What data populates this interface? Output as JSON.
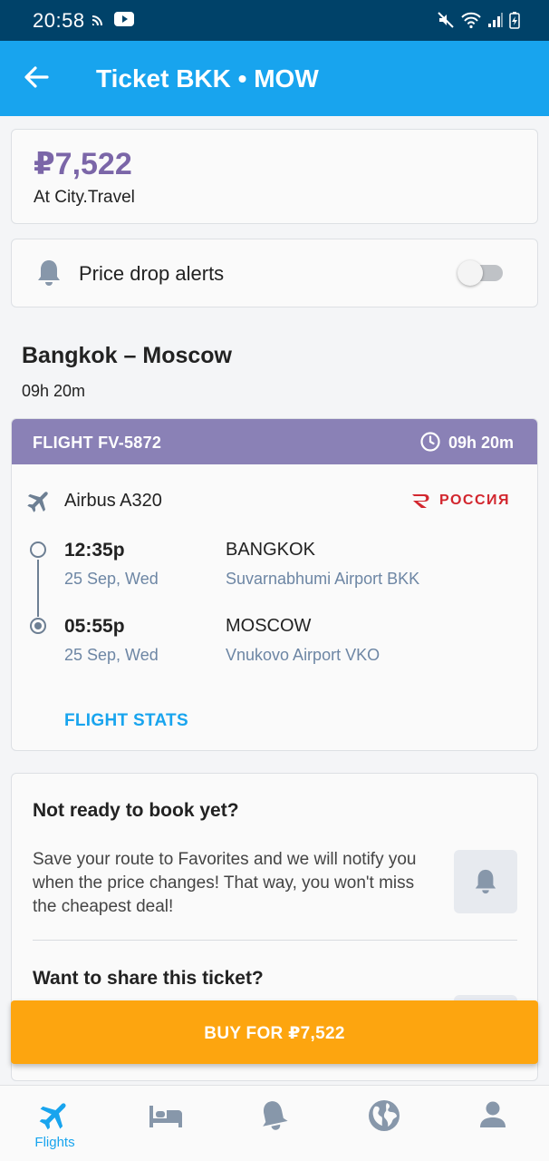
{
  "status_bar": {
    "time": "20:58"
  },
  "app_bar": {
    "title": "Ticket BKK • MOW",
    "back_icon": "arrow-left-icon"
  },
  "price_card": {
    "price": "₽7,522",
    "seller": "At City.Travel"
  },
  "price_alert": {
    "label": "Price drop alerts",
    "enabled": false
  },
  "route": {
    "title": "Bangkok – Moscow",
    "duration": "09h 20m"
  },
  "flight": {
    "number": "FLIGHT FV-5872",
    "duration": "09h 20m",
    "aircraft": "Airbus A320",
    "airline": "РОССИЯ",
    "departure": {
      "time": "12:35p",
      "date": "25 Sep, Wed",
      "city": "BANGKOK",
      "airport": "Suvarnabhumi Airport BKK"
    },
    "arrival": {
      "time": "05:55p",
      "date": "25 Sep, Wed",
      "city": "MOSCOW",
      "airport": "Vnukovo Airport VKO"
    },
    "stats_link": "FLIGHT STATS",
    "header_color": "#8a81b6"
  },
  "booking": {
    "heading": "Not ready to book yet?",
    "body": "Save your route to Favorites and we will notify you when the price changes! That way, you won't miss the cheapest deal!",
    "share_heading": "Want to share this ticket?"
  },
  "buy_button": {
    "label": "BUY FOR ₽7,522",
    "color": "#fda50f"
  },
  "bottom_nav": {
    "items": [
      {
        "icon": "airplane-icon",
        "label": "Flights",
        "active": true
      },
      {
        "icon": "hotel-bed-icon",
        "label": "",
        "active": false
      },
      {
        "icon": "bell-icon",
        "label": "",
        "active": false
      },
      {
        "icon": "globe-icon",
        "label": "",
        "active": false
      },
      {
        "icon": "profile-icon",
        "label": "",
        "active": false
      }
    ]
  },
  "colors": {
    "accent": "#18a4ee",
    "status_bar": "#004269",
    "price": "#7b66a8"
  }
}
